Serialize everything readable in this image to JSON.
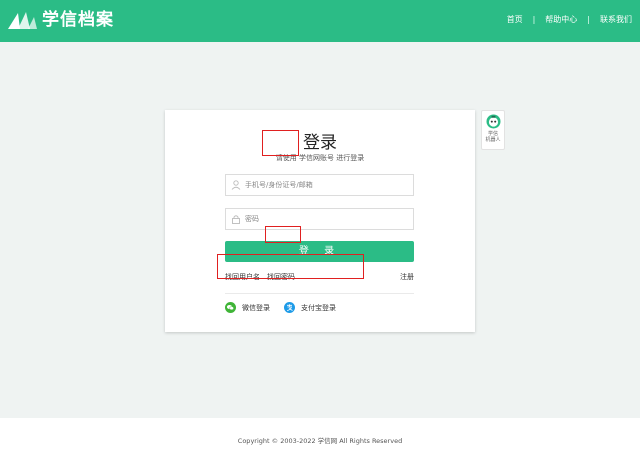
{
  "header": {
    "logo_text": "学信档案",
    "nav": [
      "首页",
      "帮助中心",
      "联系我们"
    ],
    "separator": "|"
  },
  "login": {
    "title": "登录",
    "subtitle": "请使用 学信网账号 进行登录",
    "username_placeholder": "手机号/身份证号/邮箱",
    "password_placeholder": "密码",
    "login_button": "登 录",
    "find_username": "找回用户名",
    "find_password": "找回密码",
    "register": "注册",
    "wechat_login": "微信登录",
    "alipay_login": "支付宝登录"
  },
  "robot": {
    "line1": "学信",
    "line2": "机器人"
  },
  "footer": {
    "copyright": "Copyright © 2003-2022 学信网 All Rights Reserved"
  },
  "colors": {
    "brand": "#2bbc86",
    "highlight": "#e02020",
    "background": "#eff3f2"
  }
}
